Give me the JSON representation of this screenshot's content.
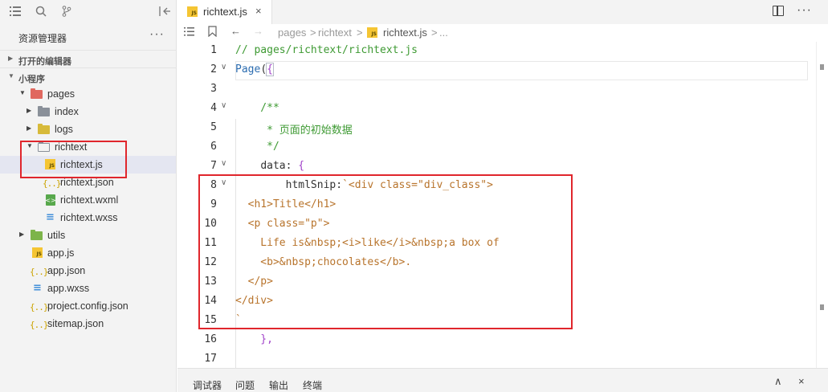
{
  "sidebar": {
    "toolbar_icons": [
      "list-icon",
      "search-icon",
      "git-branch-icon",
      "collapse-sidebar-icon"
    ],
    "title": "资源管理器",
    "more": "···",
    "sections": [
      {
        "label": "打开的编辑器",
        "expanded": false
      },
      {
        "label": "小程序",
        "expanded": true
      }
    ],
    "tree": [
      {
        "label": "pages",
        "type": "folder-red",
        "expanded": true
      },
      {
        "label": "index",
        "type": "folder-gray",
        "expanded": false
      },
      {
        "label": "logs",
        "type": "folder-yellow",
        "expanded": false
      },
      {
        "label": "richtext",
        "type": "folder-open",
        "expanded": true
      },
      {
        "label": "richtext.js",
        "type": "js",
        "selected": true
      },
      {
        "label": "richtext.json",
        "type": "json"
      },
      {
        "label": "richtext.wxml",
        "type": "wxml"
      },
      {
        "label": "richtext.wxss",
        "type": "wxss"
      },
      {
        "label": "utils",
        "type": "folder-green",
        "expanded": false
      },
      {
        "label": "app.js",
        "type": "js"
      },
      {
        "label": "app.json",
        "type": "json"
      },
      {
        "label": "app.wxss",
        "type": "wxss"
      },
      {
        "label": "project.config.json",
        "type": "json"
      },
      {
        "label": "sitemap.json",
        "type": "json"
      }
    ]
  },
  "editor": {
    "tab": {
      "label": "richtext.js",
      "close": "×",
      "icon_text": "JS"
    },
    "more": "···",
    "breadcrumb": {
      "items": [
        "pages",
        "richtext",
        "richtext.js",
        "..."
      ],
      "separator": ">"
    },
    "lines": [
      {
        "n": "1",
        "text": "// pages/richtext/richtext.js",
        "fold": ""
      },
      {
        "n": "2",
        "text": "Page({",
        "fold": "∨"
      },
      {
        "n": "3",
        "text": "",
        "fold": ""
      },
      {
        "n": "4",
        "text": "    /**",
        "fold": "∨"
      },
      {
        "n": "5",
        "text": "     * 页面的初始数据",
        "fold": ""
      },
      {
        "n": "6",
        "text": "     */",
        "fold": ""
      },
      {
        "n": "7",
        "text": "    data: {",
        "fold": "∨"
      },
      {
        "n": "8",
        "text": "        htmlSnip:`<div class=\"div_class\">",
        "fold": "∨"
      },
      {
        "n": "9",
        "text": "  <h1>Title</h1>",
        "fold": ""
      },
      {
        "n": "10",
        "text": "  <p class=\"p\">",
        "fold": ""
      },
      {
        "n": "11",
        "text": "    Life is&nbsp;<i>like</i>&nbsp;a box of",
        "fold": ""
      },
      {
        "n": "12",
        "text": "    <b>&nbsp;chocolates</b>.",
        "fold": ""
      },
      {
        "n": "13",
        "text": "  </p>",
        "fold": ""
      },
      {
        "n": "14",
        "text": "</div>",
        "fold": ""
      },
      {
        "n": "15",
        "text": "`",
        "fold": ""
      },
      {
        "n": "16",
        "text": "    },",
        "fold": ""
      },
      {
        "n": "17",
        "text": "",
        "fold": ""
      }
    ]
  },
  "bottom_panel": {
    "tabs": [
      "调试器",
      "问题",
      "输出",
      "终端"
    ],
    "up": "∧",
    "close": "×"
  },
  "colors": {
    "highlight_box": "#e0262c",
    "comment": "#3e9a33",
    "string": "#b8742c",
    "keyword_blue": "#2b6cb0",
    "brace": "#a142c9"
  }
}
